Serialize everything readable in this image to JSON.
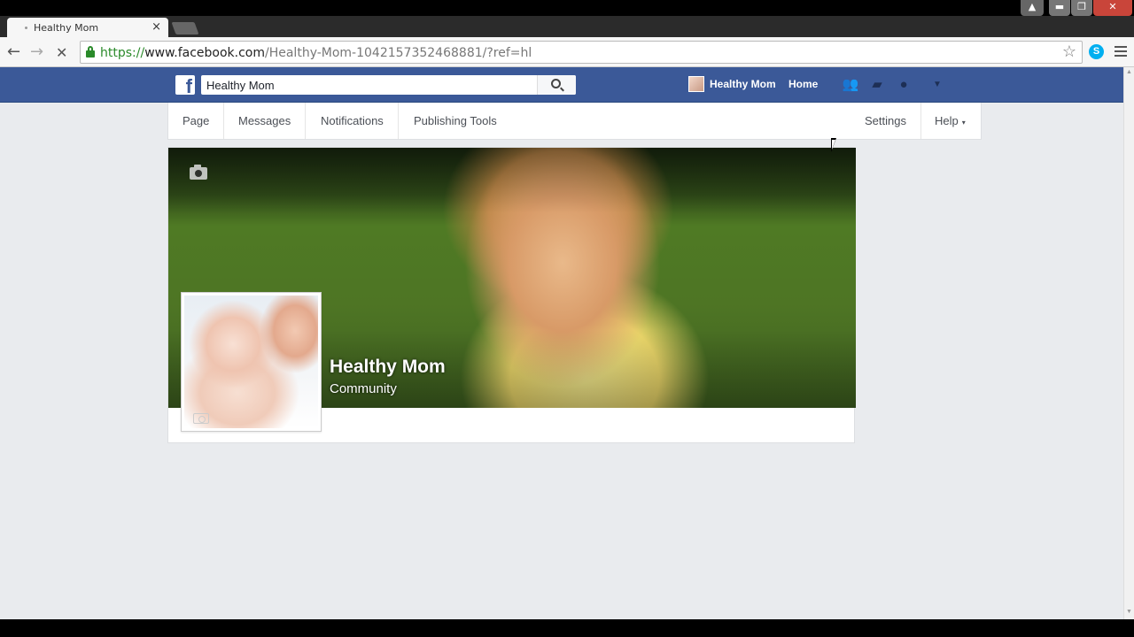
{
  "browser": {
    "tab_title": "Healthy Mom",
    "tab_close": "×",
    "url_protocol": "https://",
    "url_host": "www.facebook.com",
    "url_path": "/Healthy-Mom-1042157352468881/?ref=hl",
    "back_glyph": "←",
    "forward_glyph": "→",
    "stop_glyph": "✕",
    "star_glyph": "☆",
    "skype_glyph": "S",
    "window_user_glyph": "▲",
    "window_min_glyph": "▬",
    "window_max_glyph": "❐",
    "window_close_glyph": "✕"
  },
  "facebook": {
    "logo_glyph": "f",
    "search_value": "Healthy Mom",
    "profile_name": "Healthy Mom",
    "home_label": "Home",
    "jewels": {
      "friends_glyph": "👥",
      "messages_glyph": "▰",
      "notifications_glyph": "●",
      "menu_caret": "▼"
    }
  },
  "page_nav": {
    "items": [
      {
        "label": "Page"
      },
      {
        "label": "Messages"
      },
      {
        "label": "Notifications"
      },
      {
        "label": "Publishing Tools"
      }
    ],
    "settings_label": "Settings",
    "help_label": "Help",
    "help_caret": "▾"
  },
  "page": {
    "name": "Healthy Mom",
    "category": "Community"
  },
  "icons": {
    "lock": "lock-icon",
    "search": "search-icon",
    "camera": "camera-icon"
  },
  "colors": {
    "facebook_blue": "#3b5998",
    "page_background": "#e9ebee",
    "url_secure_green": "#2a8a2a"
  }
}
